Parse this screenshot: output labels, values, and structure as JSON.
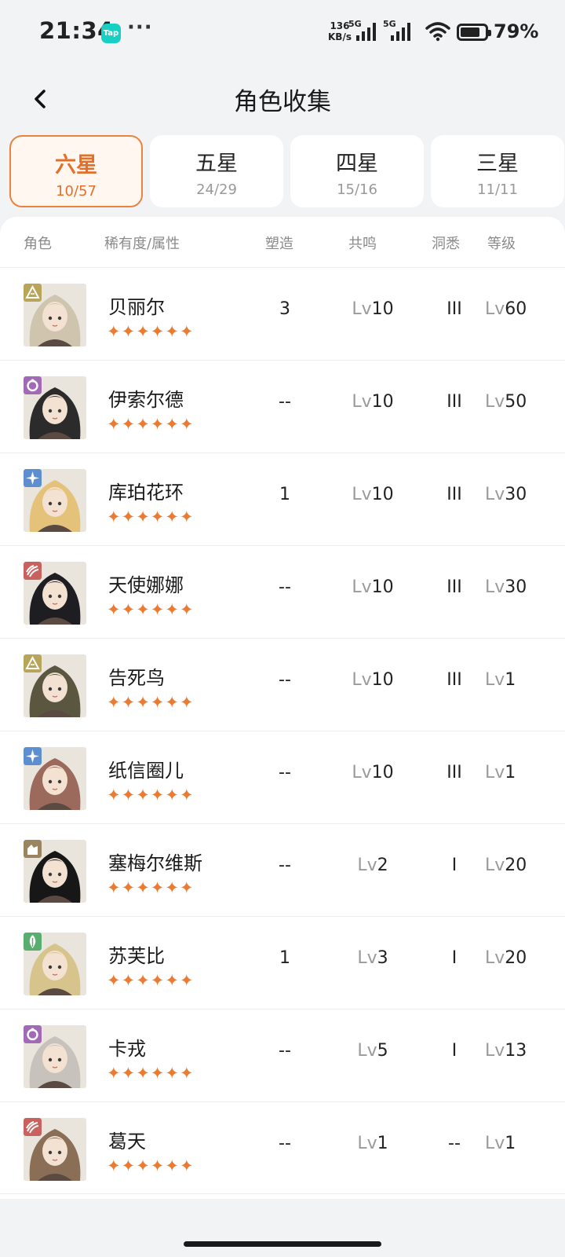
{
  "status_bar": {
    "time": "21:34",
    "app_badge": "Tap",
    "more": "···",
    "speed_value": "136",
    "speed_unit": "KB/s",
    "sim1": "5G",
    "sim2": "5G",
    "battery_level": 0.79,
    "battery_text": "79%"
  },
  "header": {
    "title": "角色收集"
  },
  "tabs": [
    {
      "label": "六星",
      "count": "10/57",
      "active": true
    },
    {
      "label": "五星",
      "count": "24/29",
      "active": false
    },
    {
      "label": "四星",
      "count": "15/16",
      "active": false
    },
    {
      "label": "三星",
      "count": "11/11",
      "active": false
    }
  ],
  "columns": {
    "role": "角色",
    "rarity": "稀有度/属性",
    "forge": "塑造",
    "resonance": "共鸣",
    "insight": "洞悉",
    "level": "等级"
  },
  "lv_prefix": "Lv",
  "stars_text": "✦✦✦✦✦✦",
  "characters": [
    {
      "name": "贝丽尔",
      "element": "triangle",
      "element_color": "#b8a55a",
      "hair": "#cfc4ad",
      "forge": "3",
      "resonance": "10",
      "insight": "III",
      "level": "60"
    },
    {
      "name": "伊索尔德",
      "element": "ring",
      "element_color": "#a26ab6",
      "hair": "#2b2b2b",
      "forge": "--",
      "resonance": "10",
      "insight": "III",
      "level": "50"
    },
    {
      "name": "库珀花环",
      "element": "star",
      "element_color": "#5d8ed0",
      "hair": "#e5c27a",
      "forge": "1",
      "resonance": "10",
      "insight": "III",
      "level": "30"
    },
    {
      "name": "天使娜娜",
      "element": "claw",
      "element_color": "#c9615e",
      "hair": "#1d1d22",
      "forge": "--",
      "resonance": "10",
      "insight": "III",
      "level": "30"
    },
    {
      "name": "告死鸟",
      "element": "triangle",
      "element_color": "#b8a55a",
      "hair": "#5b5640",
      "forge": "--",
      "resonance": "10",
      "insight": "III",
      "level": "1"
    },
    {
      "name": "纸信圈儿",
      "element": "star",
      "element_color": "#5d8ed0",
      "hair": "#9b6a5c",
      "forge": "--",
      "resonance": "10",
      "insight": "III",
      "level": "1"
    },
    {
      "name": "塞梅尔维斯",
      "element": "rock",
      "element_color": "#9a8560",
      "hair": "#171717",
      "forge": "--",
      "resonance": "2",
      "insight": "I",
      "level": "20"
    },
    {
      "name": "苏芙比",
      "element": "leaf",
      "element_color": "#58ad6f",
      "hair": "#d7c48c",
      "forge": "1",
      "resonance": "3",
      "insight": "I",
      "level": "20"
    },
    {
      "name": "卡戎",
      "element": "ring",
      "element_color": "#a26ab6",
      "hair": "#c7c2bb",
      "forge": "--",
      "resonance": "5",
      "insight": "I",
      "level": "13"
    },
    {
      "name": "葛天",
      "element": "claw",
      "element_color": "#c9615e",
      "hair": "#8a6e55",
      "forge": "--",
      "resonance": "1",
      "insight": "--",
      "level": "1"
    }
  ]
}
